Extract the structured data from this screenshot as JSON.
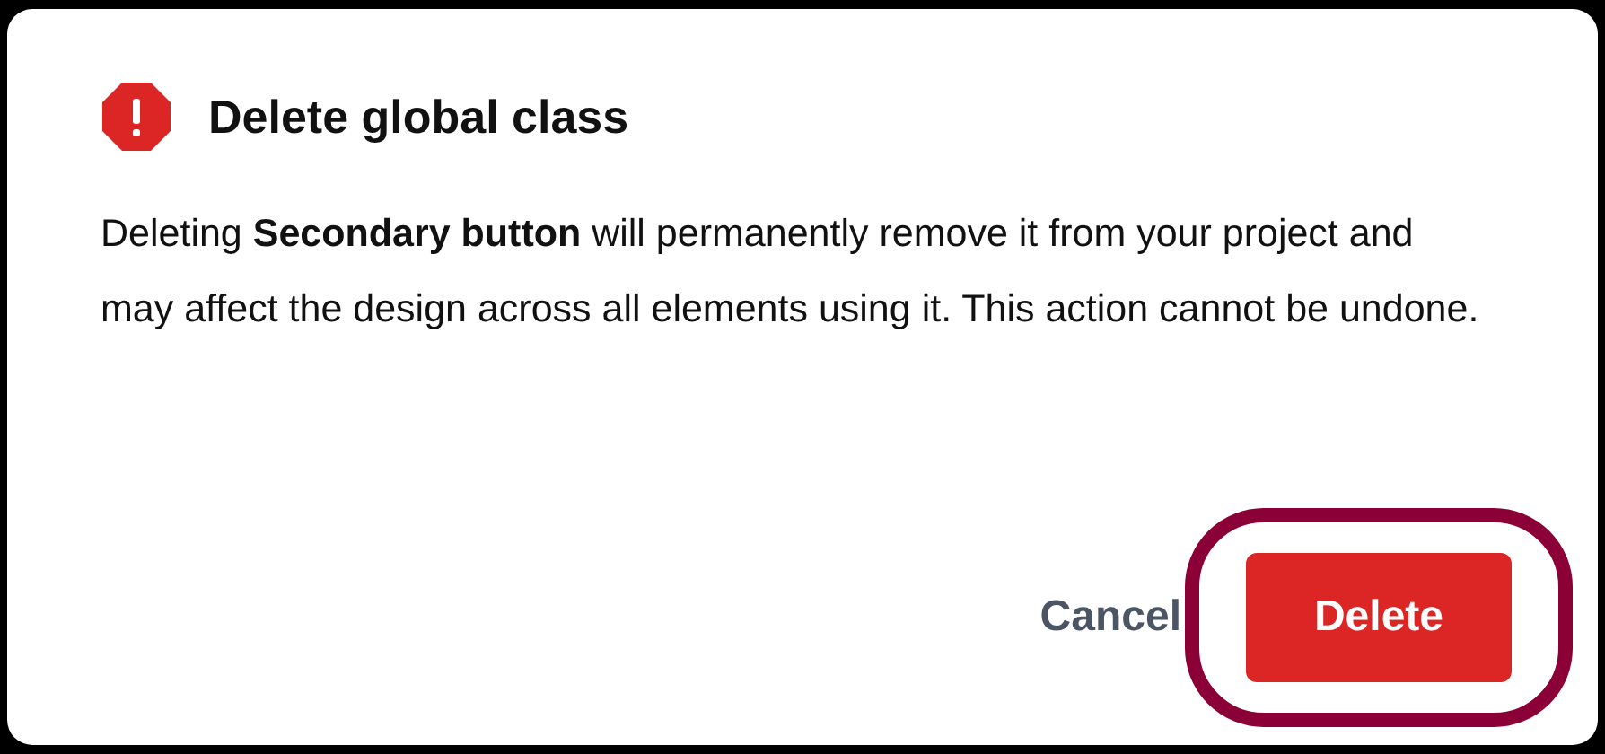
{
  "dialog": {
    "title": "Delete global class",
    "message": "Deleting **Secondary button** will permanently remove it from your project and may affect the design across all elements using it. This action cannot be undone.",
    "buttons": [
      {
        "label": "Cancel",
        "kind": "text",
        "focused": false
      },
      {
        "label": "Delete",
        "kind": "danger",
        "focused": true
      }
    ]
  }
}
